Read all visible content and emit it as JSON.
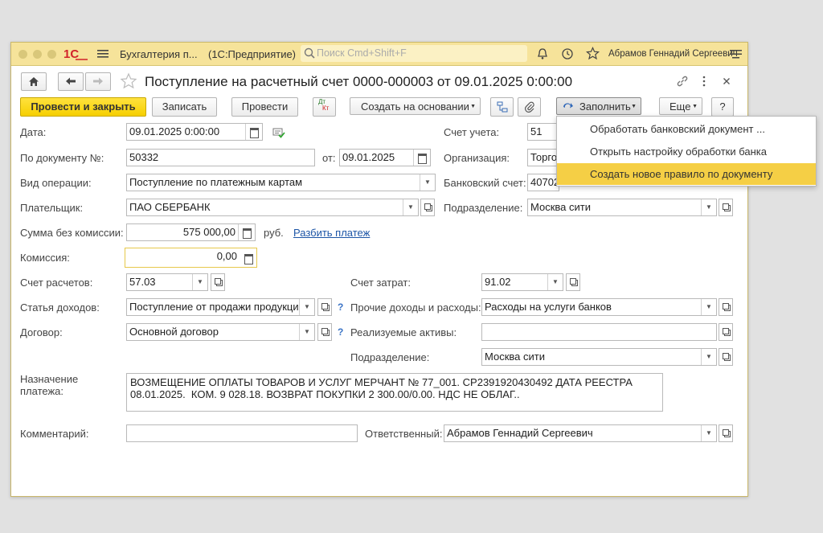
{
  "titlebar": {
    "app_title": "Бухгалтерия п...",
    "platform": "(1С:Предприятие)",
    "search_placeholder": "Поиск Cmd+Shift+F",
    "user": "Абрамов Геннадий Сергеевич"
  },
  "doc": {
    "title": "Поступление на расчетный счет 0000-000003 от 09.01.2025 0:00:00"
  },
  "toolbar": {
    "post_close": "Провести и закрыть",
    "save": "Записать",
    "post": "Провести",
    "dtkt_top": "Дт",
    "dtkt_bottom": "Кт",
    "create_based": "Создать на основании",
    "fill": "Заполнить",
    "more": "Еще",
    "help": "?"
  },
  "fill_menu": [
    "Обработать банковский документ ...",
    "Открыть настройку обработки банка",
    "Создать новое правило по документу"
  ],
  "form": {
    "date_label": "Дата:",
    "date_value": "09.01.2025  0:00:00",
    "doc_num_label": "По документу №:",
    "doc_num_value": "50332",
    "from_label": "от:",
    "from_value": "09.01.2025",
    "op_type_label": "Вид операции:",
    "op_type_value": "Поступление по платежным картам",
    "payer_label": "Плательщик:",
    "payer_value": "ПАО СБЕРБАНК",
    "sum_label": "Сумма без комиссии:",
    "sum_value": "575 000,00",
    "currency": "руб.",
    "split_link": "Разбить платеж",
    "commission_label": "Комиссия:",
    "commission_value": "0,00",
    "settle_acc_label": "Счет расчетов:",
    "settle_acc_value": "57.03",
    "income_label": "Статья доходов:",
    "income_value": "Поступление от продажи продукции",
    "contract_label": "Договор:",
    "contract_value": "Основной договор",
    "account_label": "Счет учета:",
    "account_value": "51",
    "org_label": "Организация:",
    "org_value": "Торго",
    "bank_acc_label": "Банковский счет:",
    "bank_acc_value": "40702",
    "division_label": "Подразделение:",
    "division_value": "Москва сити",
    "cost_acc_label": "Счет затрат:",
    "cost_acc_value": "91.02",
    "other_label": "Прочие доходы и расходы:",
    "other_value": "Расходы на услуги банков",
    "assets_label": "Реализуемые активы:",
    "assets_value": "",
    "division2_label": "Подразделение:",
    "division2_value": "Москва сити",
    "purpose_label_1": "Назначение",
    "purpose_label_2": "платежа:",
    "purpose_value": "ВОЗМЕЩЕНИЕ ОПЛАТЫ ТОВАРОВ И УСЛУГ МЕРЧАНТ № 77_001. СР2391920430492 ДАТА РЕЕСТРА 08.01.2025.  КОМ. 9 028.18. ВОЗВРАТ ПОКУПКИ 2 300.00/0.00. НДС НЕ ОБЛАГ..",
    "comment_label": "Комментарий:",
    "comment_value": "",
    "responsible_label": "Ответственный:",
    "responsible_value": "Абрамов Геннадий Сергеевич",
    "q": "?"
  }
}
